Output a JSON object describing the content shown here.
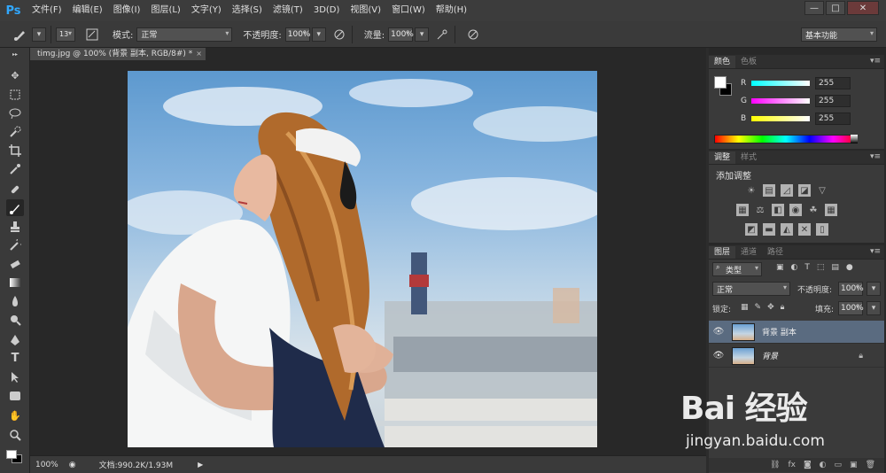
{
  "app": {
    "logo": "Ps"
  },
  "menubar": {
    "items": [
      "文件(F)",
      "编辑(E)",
      "图像(I)",
      "图层(L)",
      "文字(Y)",
      "选择(S)",
      "滤镜(T)",
      "3D(D)",
      "视图(V)",
      "窗口(W)",
      "帮助(H)"
    ]
  },
  "window_controls": {
    "minimize": "—",
    "restore": "□",
    "close": "✕"
  },
  "options": {
    "brush_size": "13",
    "mode_label": "模式:",
    "mode_value": "正常",
    "opacity_label": "不透明度:",
    "opacity_value": "100%",
    "flow_label": "流量:",
    "flow_value": "100%",
    "workspace": "基本功能"
  },
  "document": {
    "tab_title": "timg.jpg @ 100% (背景 副本, RGB/8#) *",
    "close": "×"
  },
  "status": {
    "zoom": "100%",
    "doc_info": "文档:990.2K/1.93M"
  },
  "color_panel": {
    "tabs": [
      "颜色",
      "色板"
    ],
    "channels": [
      {
        "name": "R",
        "value": "255"
      },
      {
        "name": "G",
        "value": "255"
      },
      {
        "name": "B",
        "value": "255"
      }
    ]
  },
  "adjust_panel": {
    "tabs": [
      "调整",
      "样式"
    ],
    "title": "添加调整"
  },
  "layers_panel": {
    "tabs": [
      "图层",
      "通道",
      "路径"
    ],
    "filter_label": "类型",
    "blend_mode": "正常",
    "opacity_label": "不透明度:",
    "opacity_value": "100%",
    "lock_label": "锁定:",
    "fill_label": "填充:",
    "fill_value": "100%",
    "layers": [
      {
        "name": "背景 副本"
      },
      {
        "name": "背景"
      }
    ]
  },
  "watermark": {
    "logo": "Bai 经验",
    "url": "jingyan.baidu.com"
  }
}
